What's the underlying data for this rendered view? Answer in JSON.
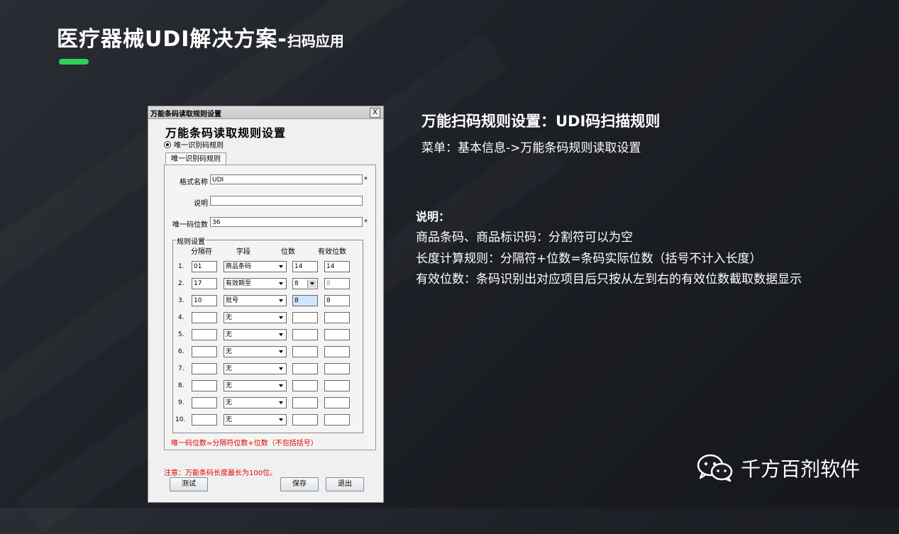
{
  "slide": {
    "title_main": "医疗器械UDI解决方案-",
    "title_sub": "扫码应用",
    "accent_color": "#2ed15c"
  },
  "dialog": {
    "window_title": "万能条码读取规则设置",
    "close_label": "X",
    "heading": "万能条码读取规则设置",
    "radio_label": "唯一识别码规则",
    "tab_label": "唯一识别码规则",
    "fields": {
      "format_name_label": "格式名称",
      "format_name_value": "UDI",
      "description_label": "说明",
      "description_value": "",
      "unique_digits_label": "唯一码位数",
      "unique_digits_value": "36",
      "required_mark": "*"
    },
    "rules": {
      "group_label": "规则设置",
      "headers": [
        "分隔符",
        "字段",
        "位数",
        "有效位数"
      ],
      "rows": [
        {
          "num": "1.",
          "separator": "01",
          "field": "商品条码",
          "digits": "14",
          "valid": "14"
        },
        {
          "num": "2.",
          "separator": "17",
          "field": "有效期至",
          "digits": "8",
          "valid": "8"
        },
        {
          "num": "3.",
          "separator": "10",
          "field": "批号",
          "digits": "8",
          "valid": "8"
        },
        {
          "num": "4.",
          "separator": "",
          "field": "无",
          "digits": "",
          "valid": ""
        },
        {
          "num": "5.",
          "separator": "",
          "field": "无",
          "digits": "",
          "valid": ""
        },
        {
          "num": "6.",
          "separator": "",
          "field": "无",
          "digits": "",
          "valid": ""
        },
        {
          "num": "7.",
          "separator": "",
          "field": "无",
          "digits": "",
          "valid": ""
        },
        {
          "num": "8.",
          "separator": "",
          "field": "无",
          "digits": "",
          "valid": ""
        },
        {
          "num": "9.",
          "separator": "",
          "field": "无",
          "digits": "",
          "valid": ""
        },
        {
          "num": "10.",
          "separator": "",
          "field": "无",
          "digits": "",
          "valid": ""
        }
      ],
      "formula_note": "唯一码位数=分隔符位数+位数（不包括括号）"
    },
    "footer_note": "注意：万能条码长度最长为100位。",
    "buttons": {
      "test": "测试",
      "save": "保存",
      "exit": "退出"
    }
  },
  "right_panel": {
    "title": "万能扫码规则设置：UDI码扫描规则",
    "menu_path": "菜单：基本信息->万能条码规则读取设置",
    "note_title": "说明：",
    "note_lines": [
      "商品条码、商品标识码：分割符可以为空",
      "长度计算规则：分隔符+位数=条码实际位数（括号不计入长度）",
      "有效位数：条码识别出对应项目后只按从左到右的有效位数截取数据显示"
    ]
  },
  "brand": {
    "name": "千方百剂软件",
    "icon": "wechat-icon"
  }
}
